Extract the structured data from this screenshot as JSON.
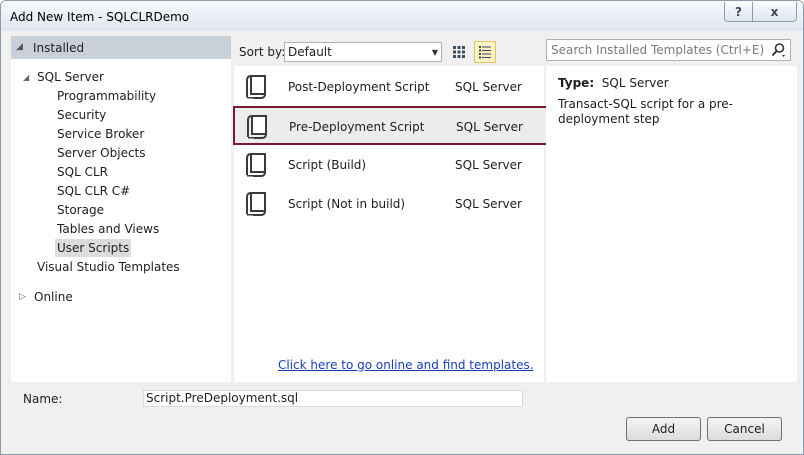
{
  "window": {
    "title": "Add New Item - SQLCLRDemo",
    "help_label": "?",
    "close_label": "x"
  },
  "tree": {
    "installed_label": "Installed",
    "sql_server_label": "SQL Server",
    "sql_server_children": [
      "Programmability",
      "Security",
      "Service Broker",
      "Server Objects",
      "SQL CLR",
      "SQL CLR C#",
      "Storage",
      "Tables and Views",
      "User Scripts"
    ],
    "selected_child": "User Scripts",
    "vs_templates_label": "Visual Studio Templates",
    "online_label": "Online"
  },
  "toolbar": {
    "sort_label": "Sort by:",
    "sort_value": "Default"
  },
  "search": {
    "placeholder": "Search Installed Templates (Ctrl+E)"
  },
  "templates": [
    {
      "name": "Post-Deployment Script",
      "category": "SQL Server"
    },
    {
      "name": "Pre-Deployment Script",
      "category": "SQL Server"
    },
    {
      "name": "Script (Build)",
      "category": "SQL Server"
    },
    {
      "name": "Script (Not in build)",
      "category": "SQL Server"
    }
  ],
  "selected_template_index": 1,
  "online_link": "Click here to go online and find templates.",
  "details": {
    "type_label": "Type:",
    "type_value": "SQL Server",
    "description": "Transact-SQL script for a pre-deployment step"
  },
  "footer": {
    "name_label": "Name:",
    "name_value": "Script.PreDeployment.sql",
    "add_label": "Add",
    "cancel_label": "Cancel"
  },
  "colors": {
    "selection_border": "#7b1a2f",
    "link": "#1a3fb4",
    "panel_header": "#c9d0d9"
  }
}
